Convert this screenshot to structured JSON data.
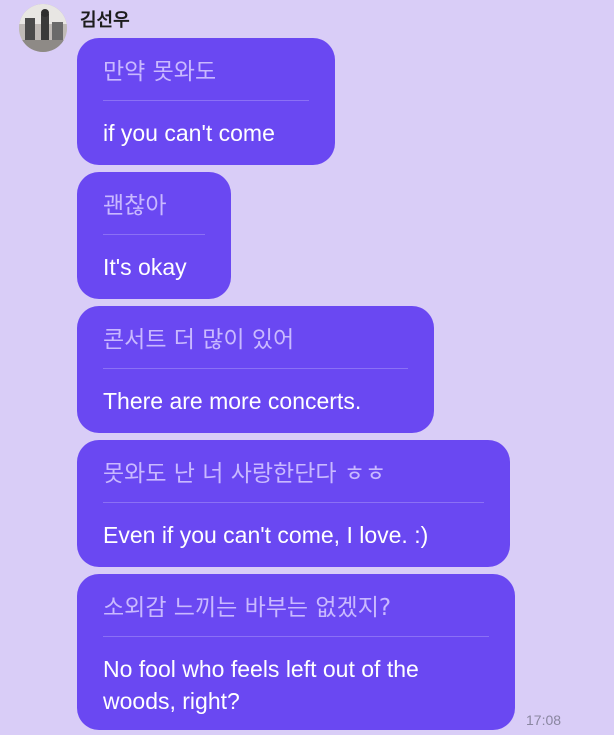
{
  "chat": {
    "sender_name": "김선우",
    "timestamp": "17:08",
    "messages": [
      {
        "original": "만약 못와도",
        "translation": "if you can't come"
      },
      {
        "original": "괜찮아",
        "translation": "It's okay"
      },
      {
        "original": "콘서트 더 많이 있어",
        "translation": "There are more concerts."
      },
      {
        "original": "못와도 난 너 사랑한단다 ㅎㅎ",
        "translation": "Even if you can't come, I love. :)"
      },
      {
        "original": "소외감 느끼는 바부는 없겠지?",
        "translation": "No fool who feels left out of the woods, right?"
      }
    ]
  },
  "colors": {
    "background": "#d9cdf7",
    "bubble": "#6a48f2",
    "original_text": "#c9b9ff",
    "translation_text": "#ffffff"
  }
}
